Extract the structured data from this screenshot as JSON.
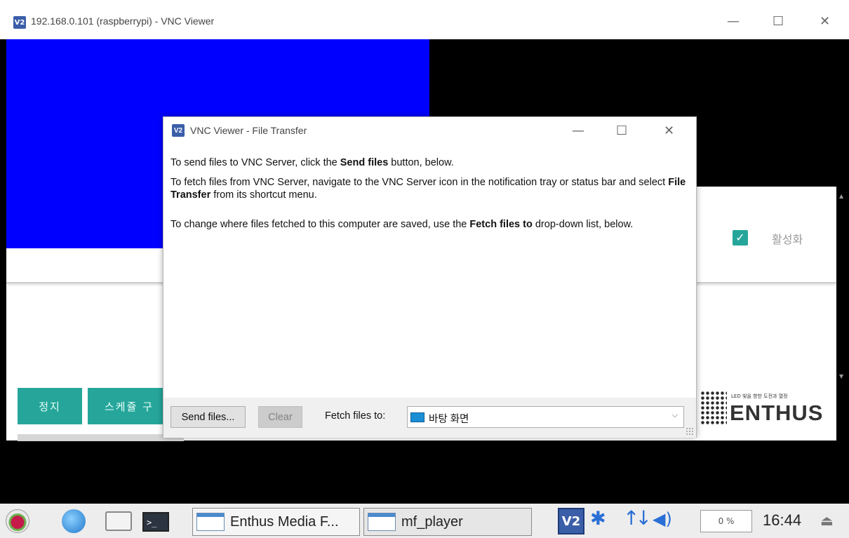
{
  "window": {
    "title": "192.168.0.101 (raspberrypi) - VNC Viewer",
    "logo": "V2",
    "controls": {
      "minimize": "—",
      "maximize": "☐",
      "close": "✕"
    }
  },
  "app": {
    "active_label": "활성화",
    "active_checked": true,
    "stop_button": "정지",
    "schedule_button": "스케쥴 구",
    "brand": {
      "tagline": "LED 빛을 향한 도전과 열정",
      "name": "ENTHUS"
    }
  },
  "dialog": {
    "title": "VNC Viewer - File Transfer",
    "logo": "V2",
    "controls": {
      "minimize": "—",
      "maximize": "☐",
      "close": "✕"
    },
    "para1_pre": "To send files to VNC Server, click the ",
    "para1_bold": "Send files",
    "para1_post": " button, below.",
    "para2_pre": "To fetch files from VNC Server, navigate to the VNC Server icon in the notification tray or status bar and select ",
    "para2_bold": "File Transfer",
    "para2_post": " from its shortcut menu.",
    "para3_pre": "To change where files fetched to this computer are saved, use the ",
    "para3_bold": "Fetch files to",
    "para3_post": " drop-down list, below.",
    "send_button": "Send files...",
    "clear_button": "Clear",
    "fetch_label": "Fetch files to:",
    "fetch_value": "바탕 화면"
  },
  "taskbar": {
    "task1": "Enthus Media F...",
    "task2": "mf_player",
    "tray_vnc": "V2",
    "cpu": "0 %",
    "clock": "16:44",
    "icons": [
      "raspberry-menu-icon",
      "web-browser-icon",
      "file-manager-icon",
      "terminal-icon",
      "bluetooth-icon",
      "network-icon",
      "volume-icon",
      "eject-icon"
    ]
  }
}
